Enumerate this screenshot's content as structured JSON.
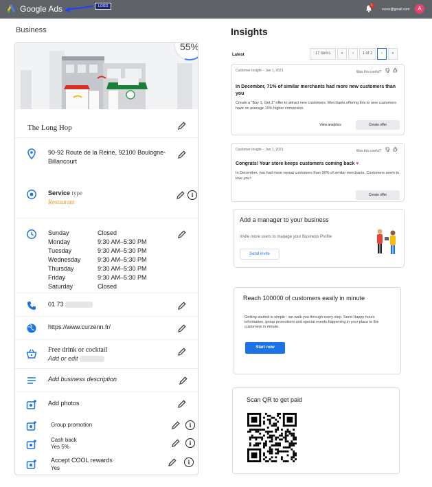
{
  "header": {
    "app_name": "Google Ads",
    "logo_tag": "LOGO",
    "notification_count": "1",
    "account_email": "xxxxx@gmail.com",
    "avatar_initial": "A"
  },
  "business": {
    "section_title": "Business",
    "completion": "55%",
    "completion_fraction": 0.55,
    "name": "The Long Hop",
    "address_line1": "90-92 Route de la Reine, 92100 Boulogne-",
    "address_line2": "Billancourt",
    "service_label": "Service",
    "service_type_label": "type",
    "service_value": "Restaurant",
    "hours": [
      {
        "day": "Sunday",
        "time": "Closed"
      },
      {
        "day": "Monday",
        "time": "9:30 AM–5:30 PM"
      },
      {
        "day": "Tuesday",
        "time": "9:30 AM–5:30 PM"
      },
      {
        "day": "Wednesday",
        "time": "9:30 AM–5:30 PM"
      },
      {
        "day": "Thursday",
        "time": "9:30 AM–5:30 PM"
      },
      {
        "day": "Friday",
        "time": "9:30 AM–5:30 PM"
      },
      {
        "day": "Saturday",
        "time": "Closed"
      }
    ],
    "phone": "01 73",
    "website": "https://www.curzenn.fr/",
    "offer_title": "Free drink or cocktail",
    "offer_sub": "Add or edit",
    "description_placeholder": "Add business description",
    "add_photos": "Add photos",
    "group_promotion": "Group promotion",
    "cash_back_title": "Cash back",
    "cash_back_value": "Yes 5%",
    "rewards_title": "Accept COOL rewards",
    "rewards_value": "Yes"
  },
  "insights": {
    "title": "Insights",
    "latest_label": "Latest",
    "pager": {
      "count": "17 items",
      "first": "«",
      "prev": "‹",
      "page": "1 of 2",
      "next": "›",
      "last": "»"
    },
    "cards": [
      {
        "meta": "Customer Insight – Jan 1, 2021",
        "useful": "Was this useful?",
        "headline": "In December, 71% of similar merchants had more new customers than you",
        "body": "Create a “Buy 1, Get 1” offer to attract new customers. Merchants offering this to new customers have on average 10% higher conversion.",
        "link": "View analytics",
        "button": "Create offer"
      },
      {
        "meta": "Customer Insight – Jan 1, 2021",
        "useful": "Was this useful?",
        "headline": "Congrats! Your store keeps customers coming back",
        "body": "In December, you had more repeat customers than 90% of similar merchants. Customers seem to love you!",
        "button": "Create offer"
      }
    ],
    "manager": {
      "title": "Add a manager to your business",
      "text": "Invite more users to manage your Business Profile",
      "button": "Send invite"
    },
    "reach": {
      "title": "Reach 100000 of customers easily in minute",
      "text": "Getting started is simple - we walk you through every step. Send  Happy hours information, group promotions and special events happening in your place to the customers in minute.",
      "button": "Start now"
    },
    "qr": {
      "title": "Scan QR to get paid"
    }
  },
  "colors": {
    "accent": "#1a73e8",
    "topbar": "#5f6368",
    "avatar": "#e8436e",
    "service_value": "#f0932b"
  }
}
